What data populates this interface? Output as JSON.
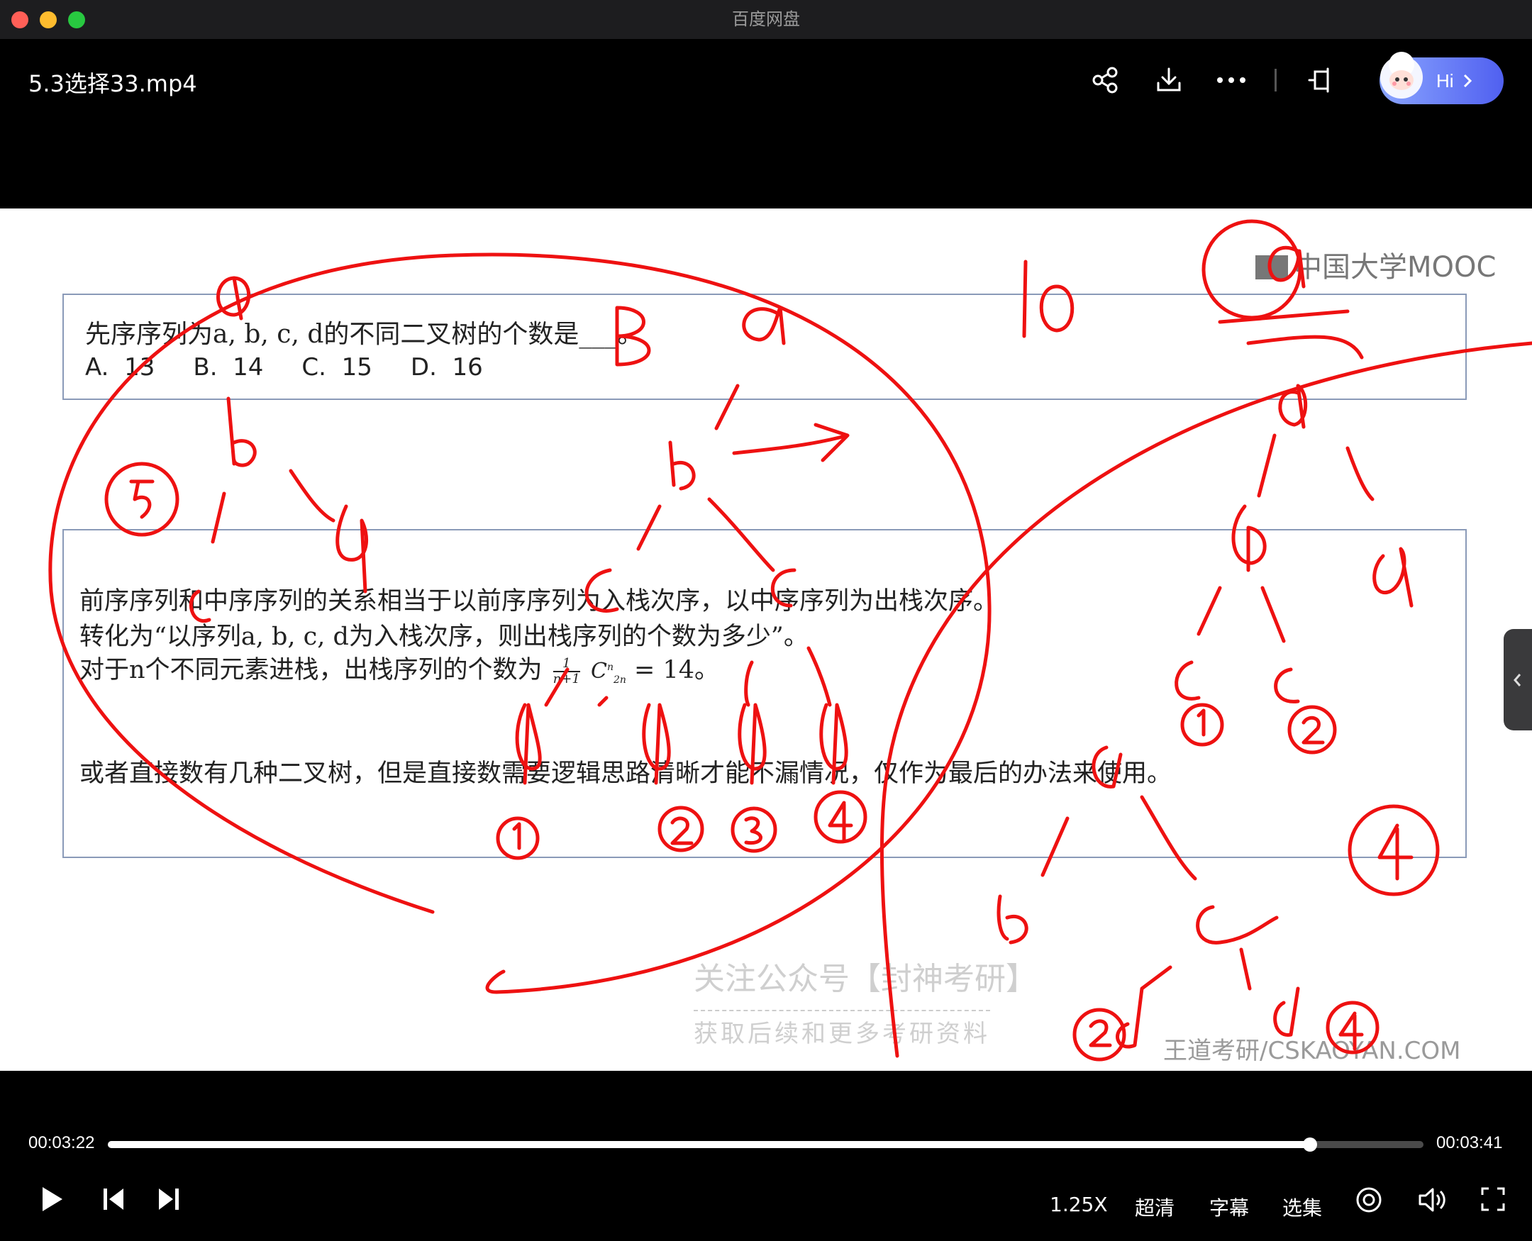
{
  "window": {
    "title": "百度网盘"
  },
  "header": {
    "filename": "5.3选择33.mp4",
    "icons": [
      "share-icon",
      "download-icon",
      "more-icon",
      "pip-icon"
    ],
    "assistant_label": "Hi"
  },
  "video": {
    "mooc_logo": "中国大学MOOC",
    "question": "先序序列为a, b, c, d的不同二叉树的个数是___。",
    "options": "A.  13     B.  14     C.  15     D.  16",
    "explanation": {
      "line1": "前序序列和中序序列的关系相当于以前序序列为入栈次序，以中序序列为出栈次序。",
      "line2": "转化为“以序列a, b, c, d为入栈次序，则出栈序列的个数为多少”。",
      "line3_prefix": "对于n个不同元素进栈，出栈序列的个数为",
      "frac_num": "1",
      "frac_den": "n+1",
      "comb_base": "C",
      "comb_sup": "n",
      "comb_sub": "2n",
      "line3_suffix": "= 14。",
      "line4": "或者直接数有几种二叉树，但是直接数需要逻辑思路清晰才能不漏情况，仅作为最后的办法来使用。"
    },
    "watermark_1": "关注公众号【封神考研】",
    "watermark_2": "获取后续和更多考研资料",
    "watermark_3": "王道考研/CSKAOYAN.COM"
  },
  "player": {
    "current_time": "00:03:22",
    "total_time": "00:03:41",
    "progress": 0.914,
    "speed": "1.25X",
    "quality": "超清",
    "subtitle": "字幕",
    "episodes": "选集"
  }
}
